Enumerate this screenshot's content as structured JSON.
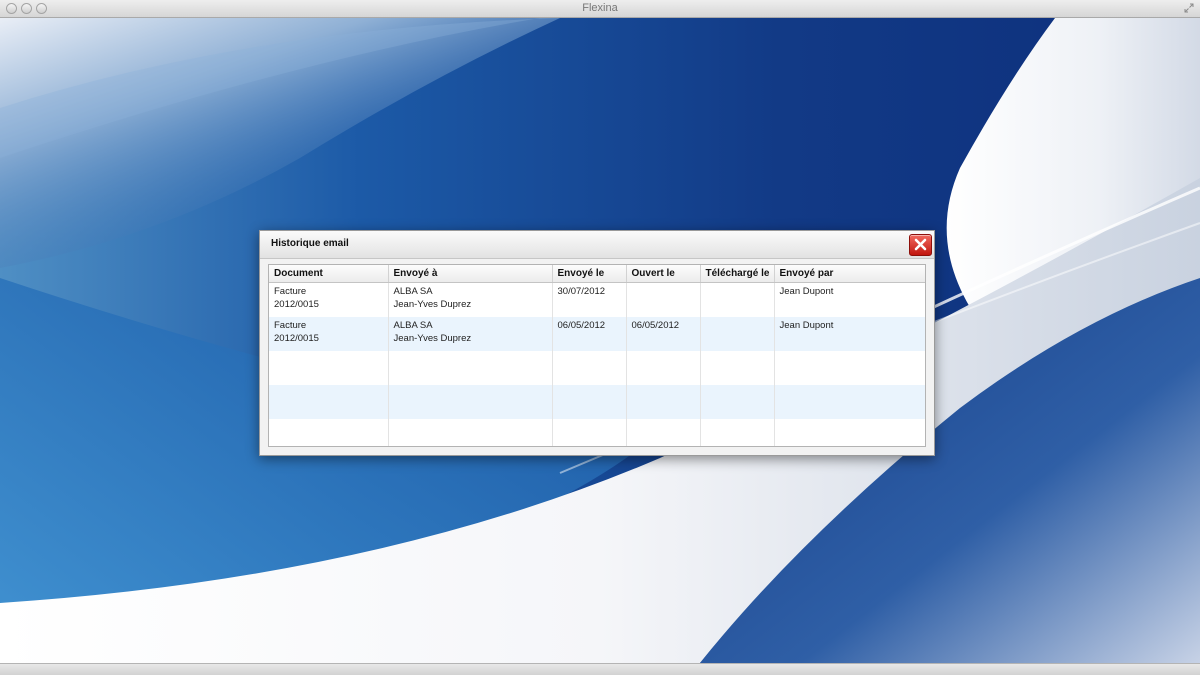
{
  "app": {
    "window_title": "Flexina"
  },
  "dialog": {
    "title": "Historique email",
    "columns": [
      "Document",
      "Envoyé à",
      "Envoyé le",
      "Ouvert le",
      "Téléchargé le",
      "Envoyé par"
    ],
    "rows": [
      {
        "document": [
          "Facture",
          "2012/0015"
        ],
        "envoye_a": [
          "ALBA SA",
          "Jean-Yves Duprez"
        ],
        "envoye_le": "30/07/2012",
        "ouvert_le": "",
        "telecharge_le": "",
        "envoye_par": "Jean Dupont"
      },
      {
        "document": [
          "Facture",
          "2012/0015"
        ],
        "envoye_a": [
          "ALBA SA",
          "Jean-Yves Duprez"
        ],
        "envoye_le": "06/05/2012",
        "ouvert_le": "06/05/2012",
        "telecharge_le": "",
        "envoye_par": "Jean Dupont"
      }
    ]
  },
  "colors": {
    "row_alt": "#eaf4fd",
    "close_button": "#d9281e",
    "background_blue": "#123a86"
  },
  "icons": {
    "close": "close-icon",
    "fullscreen": "fullscreen-icon"
  }
}
